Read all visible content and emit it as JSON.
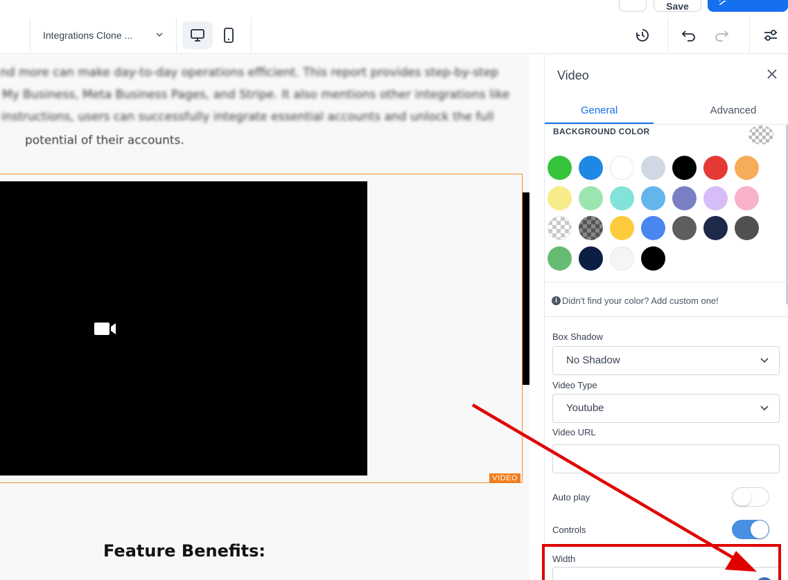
{
  "toolbar": {
    "save_label": "Save",
    "page_name": "Integrations Clone ..."
  },
  "canvas": {
    "paragraph_lines": [
      "nd more can make day-to-day operations efficient. This report provides step-by-step",
      "My Business, Meta Business Pages, and Stripe. It also mentions other integrations like",
      "instructions, users can successfully integrate essential accounts and unlock the full",
      "potential of their accounts."
    ],
    "video_tag": "VIDEO",
    "feature_title": "Feature Benefits:"
  },
  "panel": {
    "title": "Video",
    "tabs": [
      "General",
      "Advanced"
    ],
    "background_color_label": "BACKGROUND COLOR",
    "swatch_colors": [
      [
        "#35c43a",
        "#1e88e5",
        "#ffffff",
        "#cfd8e3",
        "#000000",
        "#e53935",
        "#f6ac58"
      ],
      [
        "#f8ec8a",
        "#9be5b0",
        "#81e3da",
        "#64b5ec",
        "#7a7fc4",
        "#d7bdf7",
        "#f8b2c9"
      ],
      [
        "checker",
        "checker-dark",
        "#fdcb3c",
        "#4a86f0",
        "#5e5e5e",
        "#1e2a4a",
        "#505050"
      ],
      [
        "#66bb73",
        "#0d1e45",
        "#f5f5f5",
        "#000000"
      ]
    ],
    "custom_color_hint": "Didn't find your color? Add custom one!",
    "box_shadow": {
      "label": "Box Shadow",
      "value": "No Shadow"
    },
    "video_type": {
      "label": "Video Type",
      "value": "Youtube"
    },
    "video_url": {
      "label": "Video URL",
      "value": ""
    },
    "auto_play": {
      "label": "Auto play",
      "enabled": false
    },
    "controls": {
      "label": "Controls",
      "enabled": true
    },
    "width": {
      "label": "Width"
    }
  },
  "colors": {
    "accent": "#1570ef",
    "selection_border": "#f08c2a",
    "annotation": "#e00000"
  }
}
